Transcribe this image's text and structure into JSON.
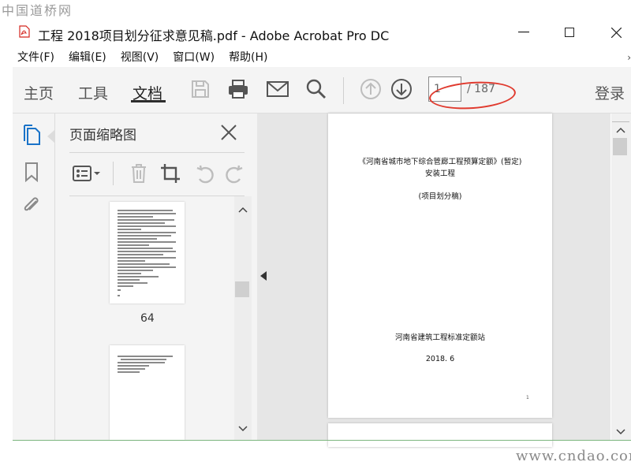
{
  "watermark_top": "中国道桥网",
  "watermark_bottom": "www.cndao.com",
  "window": {
    "title": "工程 2018项目划分征求意见稿.pdf - Adobe Acrobat Pro DC",
    "minimize": "—",
    "maximize": "☐",
    "close": "✕"
  },
  "menu": {
    "items": [
      "文件(F)",
      "编辑(E)",
      "视图(V)",
      "窗口(W)",
      "帮助(H)"
    ],
    "more": "›"
  },
  "toolbar": {
    "tabs": [
      "主页",
      "工具",
      "文档"
    ],
    "active_tab": "文档",
    "icons": [
      "save-icon",
      "print-icon",
      "email-icon",
      "search-icon",
      "page-up-icon",
      "page-down-icon"
    ],
    "page_current": "1",
    "page_total": "/ 187",
    "login": "登录"
  },
  "rail": {
    "icons": [
      "page-thumbnails-icon",
      "bookmark-icon",
      "attachment-icon"
    ]
  },
  "panel": {
    "title": "页面缩略图",
    "tools": [
      "thumbnail-options-icon",
      "delete-icon",
      "crop-icon",
      "undo-icon",
      "redo-icon"
    ],
    "thumbnails": [
      {
        "label": "64"
      },
      {
        "label": ""
      }
    ]
  },
  "document": {
    "line1": "《河南省城市地下综合管廊工程预算定额》(暂定)",
    "line2": "安装工程",
    "line3": "(项目划分稿)",
    "org": "河南省建筑工程标准定额站",
    "date": "2018. 6",
    "footer_mark": "1"
  },
  "colors": {
    "toolbar_bg": "#f4f4f4",
    "annotation_ellipse": "#e03a2e",
    "doc_bg": "#e6e6e6",
    "pdf_icon": "#d4261f"
  }
}
